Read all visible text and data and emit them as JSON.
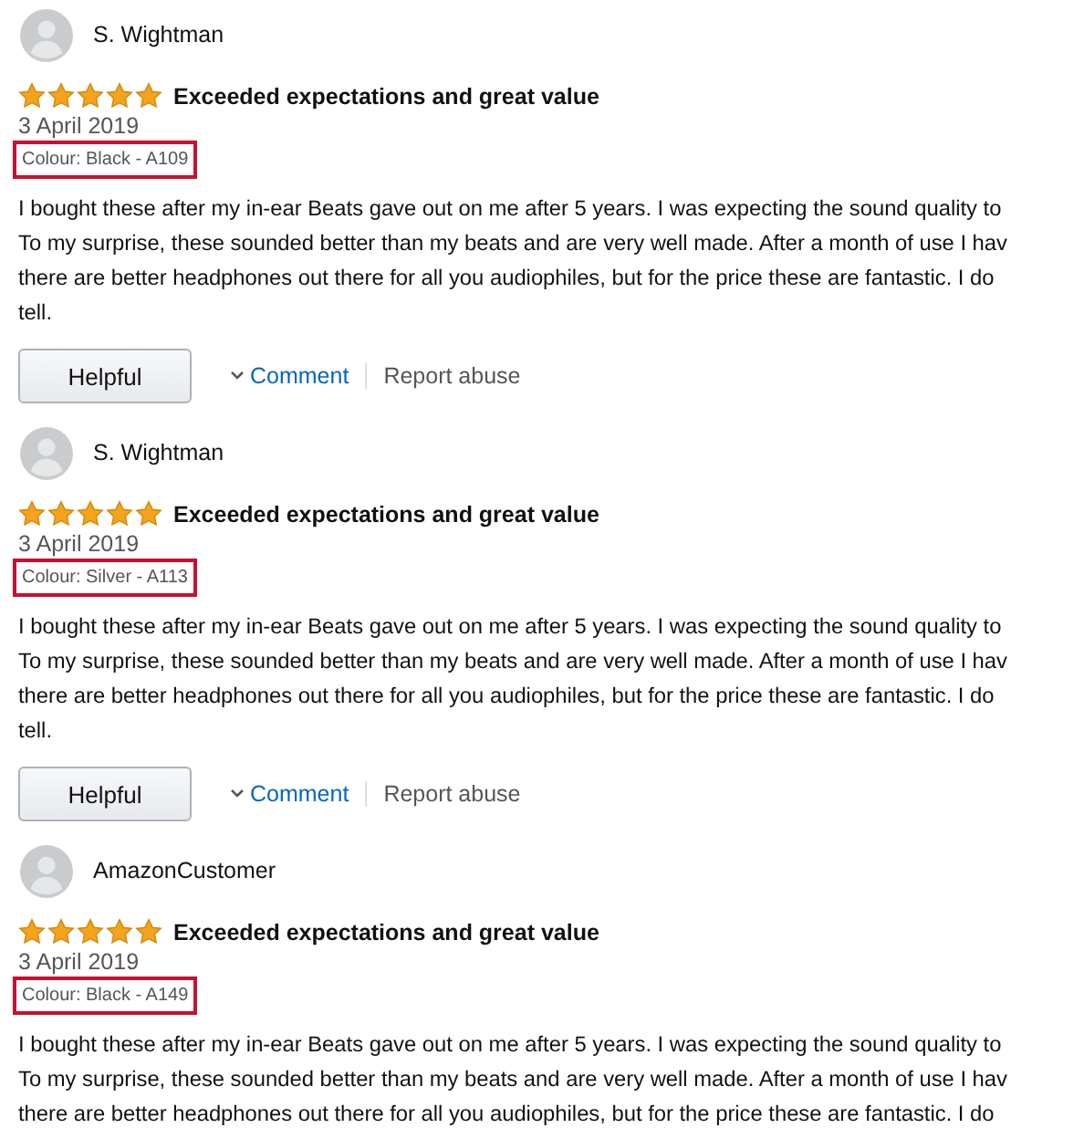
{
  "reviews": [
    {
      "author": "S. Wightman",
      "stars": 5,
      "title": "Exceeded expectations and great value",
      "date": "3 April 2019",
      "variant": {
        "text": "Colour: Black - A109",
        "highlighted": true
      },
      "body_lines": [
        "I bought these after my in-ear Beats gave out on me after 5 years. I was expecting the sound quality to",
        "To my surprise, these sounded better than my beats and are very well made. After a month of use I hav",
        "there are better headphones out there for all you audiophiles, but for the price these are fantastic. I do",
        "tell."
      ],
      "actions": {
        "helpful": "Helpful",
        "comment": "Comment",
        "report": "Report abuse"
      }
    },
    {
      "author": "S. Wightman",
      "stars": 5,
      "title": "Exceeded expectations and great value",
      "date": "3 April 2019",
      "variant": {
        "text": "Colour: Silver - A113",
        "highlighted": true
      },
      "body_lines": [
        "I bought these after my in-ear Beats gave out on me after 5 years. I was expecting the sound quality to",
        "To my surprise, these sounded better than my beats and are very well made. After a month of use I hav",
        "there are better headphones out there for all you audiophiles, but for the price these are fantastic. I do",
        "tell."
      ],
      "actions": {
        "helpful": "Helpful",
        "comment": "Comment",
        "report": "Report abuse"
      }
    },
    {
      "author": "AmazonCustomer",
      "stars": 5,
      "title": "Exceeded expectations and great value",
      "date": "3 April 2019",
      "variant": {
        "text": "Colour: Black - A149",
        "highlighted": true
      },
      "body_lines": [
        "I bought these after my in-ear Beats gave out on me after 5 years. I was expecting the sound quality to",
        "To my surprise, these sounded better than my beats and are very well made. After a month of use I hav",
        "there are better headphones out there for all you audiophiles, but for the price these are fantastic. I do"
      ]
    }
  ]
}
